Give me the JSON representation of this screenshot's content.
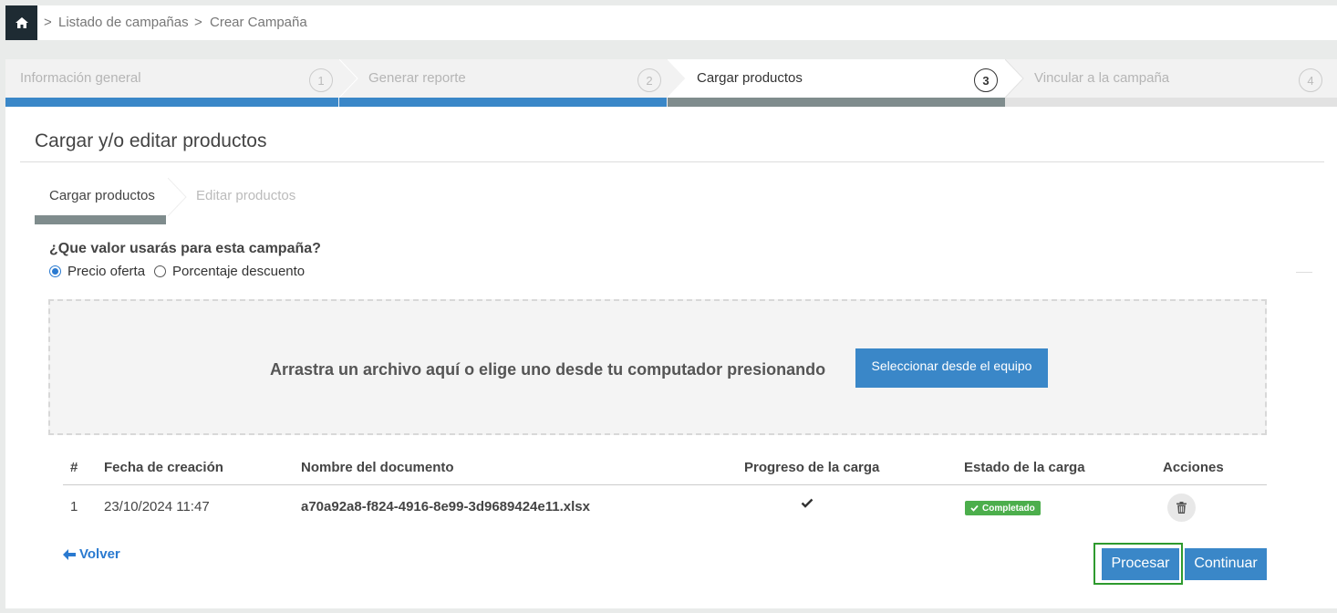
{
  "breadcrumb": {
    "home_icon": "home-icon",
    "items": [
      "Listado de campañas",
      "Crear Campaña"
    ],
    "separator": ">"
  },
  "stepper": {
    "steps": [
      {
        "label": "Información general",
        "number": "1",
        "state": "done"
      },
      {
        "label": "Generar reporte",
        "number": "2",
        "state": "done"
      },
      {
        "label": "Cargar productos",
        "number": "3",
        "state": "active"
      },
      {
        "label": "Vincular a la campaña",
        "number": "4",
        "state": "pending"
      }
    ],
    "colors": {
      "done": "#3a87c8",
      "active": "#7f8c8d",
      "pending": "#e2e2e2"
    }
  },
  "panel": {
    "title": "Cargar y/o editar productos",
    "subtabs": [
      "Cargar productos",
      "Editar productos"
    ],
    "question": "¿Que valor usarás para esta campaña?",
    "options": [
      {
        "label": "Precio oferta",
        "checked": true
      },
      {
        "label": "Porcentaje descuento",
        "checked": false
      }
    ]
  },
  "dropzone": {
    "text": "Arrastra un archivo aquí o elige uno desde tu computador presionando",
    "button": "Seleccionar desde el equipo"
  },
  "table": {
    "headers": [
      "#",
      "Fecha de creación",
      "Nombre del documento",
      "Progreso de la carga",
      "Estado de la carga",
      "Acciones"
    ],
    "rows": [
      {
        "num": "1",
        "date": "23/10/2024 11:47",
        "name": "a70a92a8-f824-4916-8e99-3d9689424e11.xlsx",
        "progress_icon": "check-icon",
        "status": "Completado",
        "action_icon": "trash-icon"
      }
    ]
  },
  "footer": {
    "back": "Volver",
    "process": "Procesar",
    "continue": "Continuar"
  }
}
